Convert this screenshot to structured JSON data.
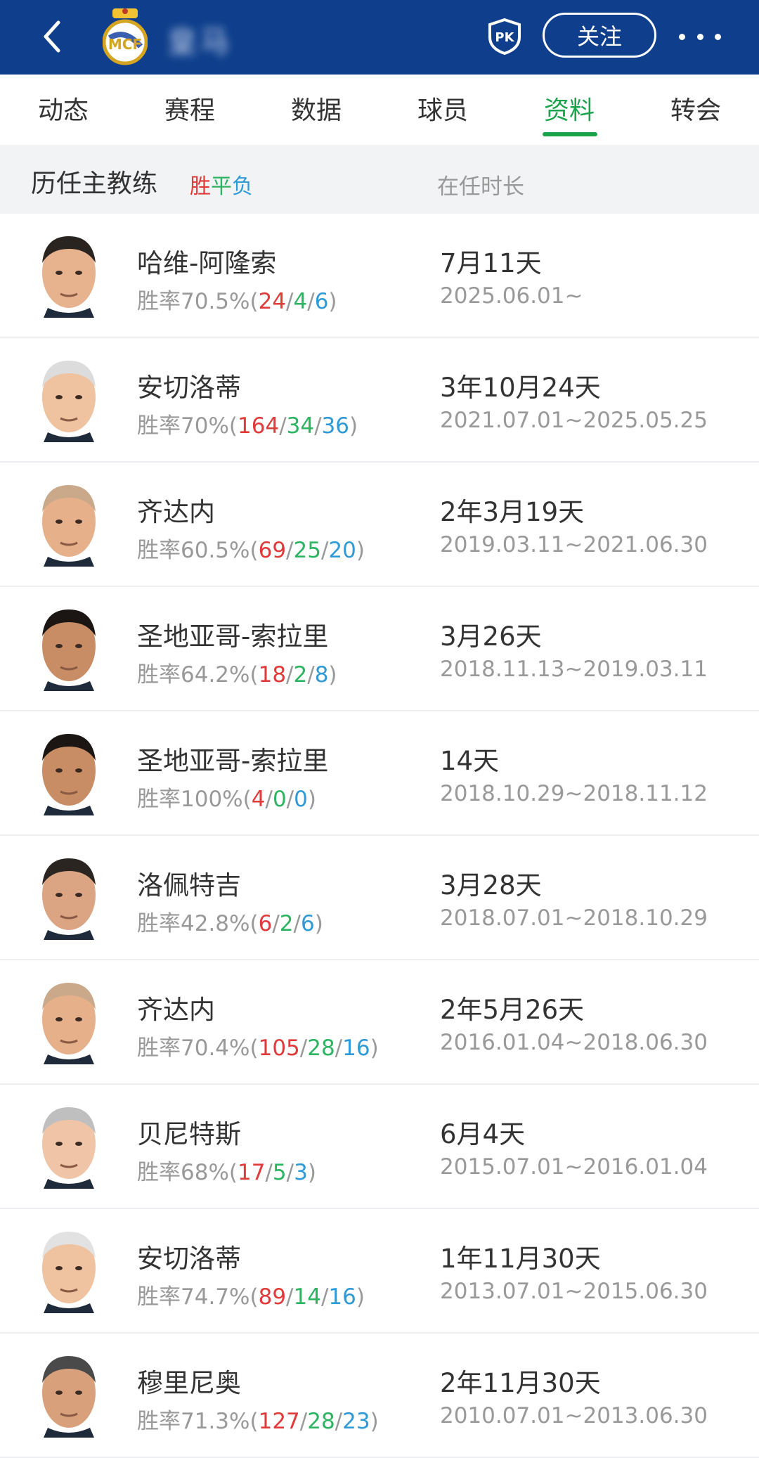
{
  "header": {
    "team_name": "皇马",
    "follow_label": "关注",
    "pk_label": "PK"
  },
  "tabs": [
    {
      "label": "动态",
      "active": false
    },
    {
      "label": "赛程",
      "active": false
    },
    {
      "label": "数据",
      "active": false
    },
    {
      "label": "球员",
      "active": false
    },
    {
      "label": "资料",
      "active": true
    },
    {
      "label": "转会",
      "active": false
    }
  ],
  "section": {
    "title": "历任主教练",
    "legend_win": "胜",
    "legend_draw": "平",
    "legend_loss": "负",
    "tenure_header": "在任时长"
  },
  "coaches": [
    {
      "name": "哈维-阿隆索",
      "rate": "胜率70.5%",
      "w": "24",
      "d": "4",
      "l": "6",
      "duration": "7月11天",
      "period": "2025.06.01~"
    },
    {
      "name": "安切洛蒂",
      "rate": "胜率70%",
      "w": "164",
      "d": "34",
      "l": "36",
      "duration": "3年10月24天",
      "period": "2021.07.01~2025.05.25"
    },
    {
      "name": "齐达内",
      "rate": "胜率60.5%",
      "w": "69",
      "d": "25",
      "l": "20",
      "duration": "2年3月19天",
      "period": "2019.03.11~2021.06.30"
    },
    {
      "name": "圣地亚哥-索拉里",
      "rate": "胜率64.2%",
      "w": "18",
      "d": "2",
      "l": "8",
      "duration": "3月26天",
      "period": "2018.11.13~2019.03.11"
    },
    {
      "name": "圣地亚哥-索拉里",
      "rate": "胜率100%",
      "w": "4",
      "d": "0",
      "l": "0",
      "duration": "14天",
      "period": "2018.10.29~2018.11.12"
    },
    {
      "name": "洛佩特吉",
      "rate": "胜率42.8%",
      "w": "6",
      "d": "2",
      "l": "6",
      "duration": "3月28天",
      "period": "2018.07.01~2018.10.29"
    },
    {
      "name": "齐达内",
      "rate": "胜率70.4%",
      "w": "105",
      "d": "28",
      "l": "16",
      "duration": "2年5月26天",
      "period": "2016.01.04~2018.06.30"
    },
    {
      "name": "贝尼特斯",
      "rate": "胜率68%",
      "w": "17",
      "d": "5",
      "l": "3",
      "duration": "6月4天",
      "period": "2015.07.01~2016.01.04"
    },
    {
      "name": "安切洛蒂",
      "rate": "胜率74.7%",
      "w": "89",
      "d": "14",
      "l": "16",
      "duration": "1年11月30天",
      "period": "2013.07.01~2015.06.30"
    },
    {
      "name": "穆里尼奥",
      "rate": "胜率71.3%",
      "w": "127",
      "d": "28",
      "l": "23",
      "duration": "2年11月30天",
      "period": "2010.07.01~2013.06.30"
    }
  ],
  "colors": {
    "header_bg": "#0f3f8c",
    "accent_green": "#1aa34a",
    "win": "#e03a3a",
    "draw": "#2db462",
    "loss": "#2f9ad6"
  }
}
